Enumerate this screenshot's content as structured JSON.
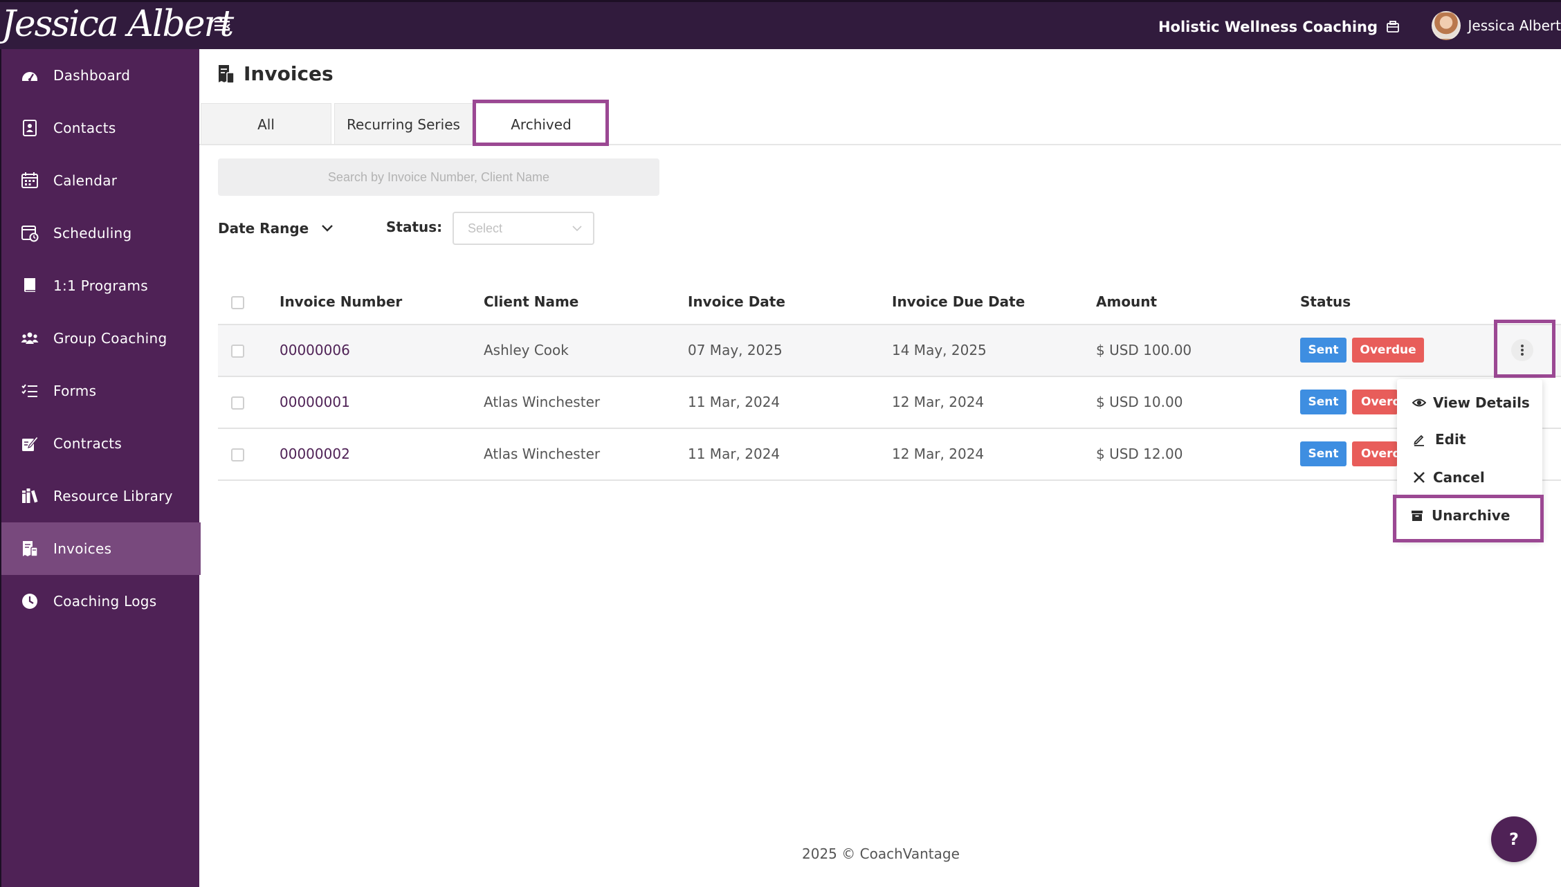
{
  "header": {
    "logo_text": "Jessica Albert",
    "organization": "Holistic Wellness Coaching",
    "user_name": "Jessica Albert",
    "background": "#311b3d"
  },
  "sidebar": {
    "background": "#4f2256",
    "active_background": "#78497d",
    "items": [
      {
        "label": "Dashboard",
        "icon": "dashboard-icon"
      },
      {
        "label": "Contacts",
        "icon": "contacts-icon"
      },
      {
        "label": "Calendar",
        "icon": "calendar-icon"
      },
      {
        "label": "Scheduling",
        "icon": "scheduling-icon"
      },
      {
        "label": "1:1 Programs",
        "icon": "book-icon"
      },
      {
        "label": "Group Coaching",
        "icon": "group-icon"
      },
      {
        "label": "Forms",
        "icon": "forms-icon"
      },
      {
        "label": "Contracts",
        "icon": "contract-icon"
      },
      {
        "label": "Resource Library",
        "icon": "library-icon"
      },
      {
        "label": "Invoices",
        "icon": "invoice-icon",
        "active": true
      },
      {
        "label": "Coaching Logs",
        "icon": "clock-icon"
      }
    ]
  },
  "page": {
    "title": "Invoices",
    "tabs": [
      {
        "label": "All"
      },
      {
        "label": "Recurring Series"
      },
      {
        "label": "Archived",
        "active": true
      }
    ],
    "search_placeholder": "Search by Invoice Number, Client Name",
    "filters": {
      "date_range_label": "Date Range",
      "status_label": "Status:",
      "status_placeholder": "Select"
    }
  },
  "table": {
    "columns": [
      "Invoice Number",
      "Client Name",
      "Invoice Date",
      "Invoice Due Date",
      "Amount",
      "Status"
    ],
    "rows": [
      {
        "invoice_number": "00000006",
        "client": "Ashley Cook",
        "invoice_date": "07 May, 2025",
        "due_date": "14 May, 2025",
        "amount": "$ USD 100.00",
        "status_sent": "Sent",
        "status_overdue": "Overdue"
      },
      {
        "invoice_number": "00000001",
        "client": "Atlas Winchester",
        "invoice_date": "11 Mar, 2024",
        "due_date": "12 Mar, 2024",
        "amount": "$ USD 10.00",
        "status_sent": "Sent",
        "status_overdue": "Overdue"
      },
      {
        "invoice_number": "00000002",
        "client": "Atlas Winchester",
        "invoice_date": "11 Mar, 2024",
        "due_date": "12 Mar, 2024",
        "amount": "$ USD 12.00",
        "status_sent": "Sent",
        "status_overdue": "Overdue"
      }
    ]
  },
  "row_menu": {
    "items": [
      {
        "label": "View Details",
        "icon": "eye-icon"
      },
      {
        "label": "Edit",
        "icon": "pencil-icon"
      },
      {
        "label": "Cancel",
        "icon": "close-icon"
      },
      {
        "label": "Unarchive",
        "icon": "archive-icon"
      }
    ]
  },
  "footer": {
    "text": "2025 © CoachVantage"
  },
  "help_button": {
    "label": "?"
  },
  "colors": {
    "brand": "#4f2256",
    "highlight": "#9b4893",
    "sent": "#3e8ee1",
    "overdue": "#e85d5a"
  }
}
